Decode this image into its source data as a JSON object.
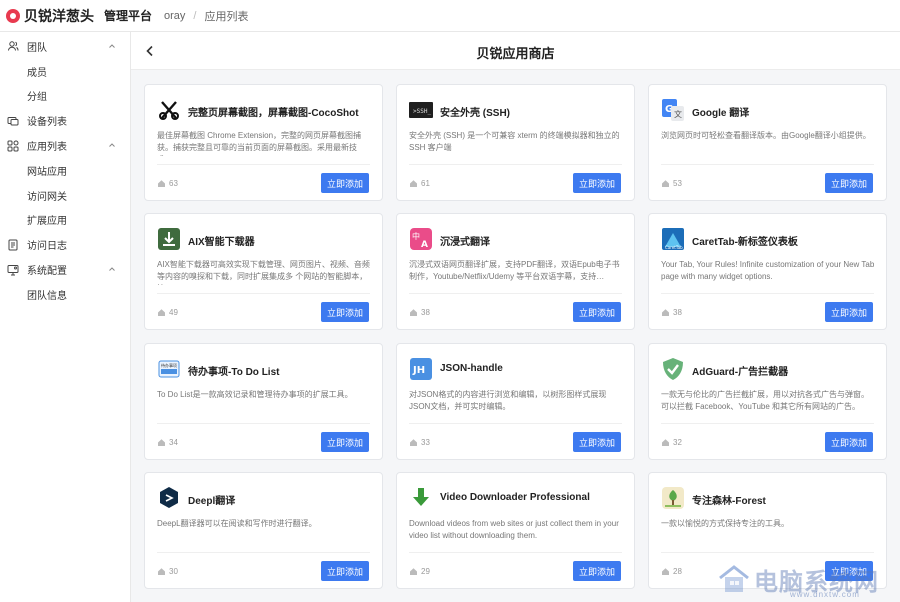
{
  "topbar": {
    "brand": "贝锐洋葱头",
    "platform": "管理平台",
    "breadcrumb": [
      "oray",
      "应用列表"
    ],
    "breadcrumb_sep": "/"
  },
  "sidebar": {
    "items": [
      {
        "label": "团队",
        "icon": "team-icon",
        "type": "group",
        "arrow": "up"
      },
      {
        "label": "成员",
        "type": "sub"
      },
      {
        "label": "分组",
        "type": "sub"
      },
      {
        "label": "设备列表",
        "icon": "devices-icon",
        "type": "group"
      },
      {
        "label": "应用列表",
        "icon": "apps-icon",
        "type": "group",
        "arrow": "up"
      },
      {
        "label": "网站应用",
        "type": "sub"
      },
      {
        "label": "访问网关",
        "type": "sub"
      },
      {
        "label": "扩展应用",
        "type": "sub"
      },
      {
        "label": "访问日志",
        "icon": "log-icon",
        "type": "group"
      },
      {
        "label": "系统配置",
        "icon": "settings-icon",
        "type": "group",
        "arrow": "up"
      },
      {
        "label": "团队信息",
        "type": "sub"
      }
    ]
  },
  "main": {
    "title": "贝锐应用商店",
    "add_label": "立即添加",
    "cards": [
      {
        "title": "完整页屏幕截图，屏幕截图-CocoShot",
        "desc": "最佳屏幕截图 Chrome Extension，完整的网页屏幕截图捕获。捕获完整且可靠的当前页面的屏幕截图。采用最新技术…",
        "count": "63",
        "icon": "cocoshot-icon"
      },
      {
        "title": "安全外壳 (SSH)",
        "desc": "安全外壳 (SSH) 是一个可兼容 xterm 的终端模拟器和独立的 SSH 客户端",
        "count": "61",
        "icon": "ssh-icon"
      },
      {
        "title": "Google 翻译",
        "desc": "浏览网页时可轻松查看翻译版本。由Google翻译小组提供。",
        "count": "53",
        "icon": "google-translate-icon"
      },
      {
        "title": "AIX智能下载器",
        "desc": "AIX智能下载器可高效实现下载管理、网页图片、视频、音频等内容的嗅探和下载，同时扩展集成多 个网站的智能脚本，快…",
        "count": "49",
        "icon": "download-icon"
      },
      {
        "title": "沉浸式翻译",
        "desc": "沉浸式双语网页翻译扩展，支持PDF翻译，双语Epub电子书制作，Youtube/Netflix/Udemy 等平台双语字幕，支持…",
        "count": "38",
        "icon": "immersive-translate-icon"
      },
      {
        "title": "CaretTab-新标签仪表板",
        "desc": "Your Tab, Your Rules! Infinite customization of your New Tab page with many widget options.",
        "count": "38",
        "icon": "carettab-icon"
      },
      {
        "title": "待办事项-To Do List",
        "desc": "To Do List是一款高效记录和管理待办事项的扩展工具。",
        "count": "34",
        "icon": "todo-icon"
      },
      {
        "title": "JSON-handle",
        "desc": "对JSON格式的内容进行浏览和编辑，以树形图样式展现JSON文档，并可实时编辑。",
        "count": "33",
        "icon": "json-icon"
      },
      {
        "title": "AdGuard-广告拦截器",
        "desc": "一款无与伦比的广告拦截扩展，用以对抗各式广告与弹窗。可以拦截 Facebook、YouTube 和其它所有网站的广告。",
        "count": "32",
        "icon": "adguard-icon"
      },
      {
        "title": "Deepl翻译",
        "desc": "DeepL翻译器可以在阅读和写作时进行翻译。",
        "count": "30",
        "icon": "deepl-icon"
      },
      {
        "title": "Video Downloader Professional",
        "desc": "Download videos from web sites or just collect them in your video list without downloading them.",
        "count": "29",
        "icon": "video-download-icon"
      },
      {
        "title": "专注森林-Forest",
        "desc": "一款以愉悦的方式保持专注的工具。",
        "count": "28",
        "icon": "forest-icon"
      }
    ]
  },
  "watermark": {
    "text": "电脑系统网",
    "url": "www.dnxtw.com"
  },
  "colors": {
    "accent": "#3d7af0",
    "brand": "#e83a4f"
  }
}
